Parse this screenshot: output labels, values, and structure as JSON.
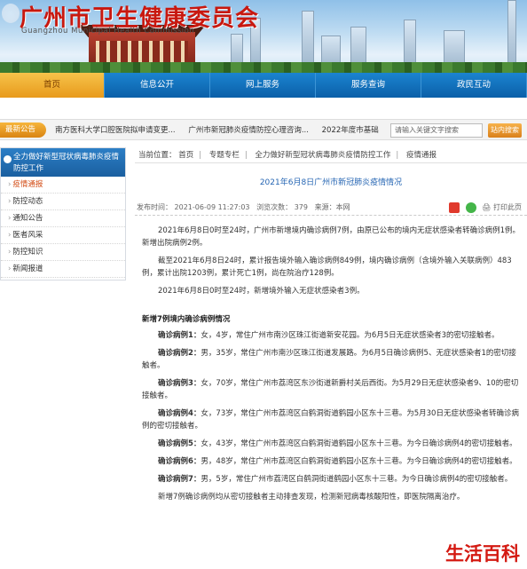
{
  "header": {
    "title": "广州市卫生健康委员会",
    "subtitle": "Guangzhou Municipal Health Commission"
  },
  "nav": {
    "items": [
      "首页",
      "信息公开",
      "网上服务",
      "服务查询",
      "政民互动"
    ]
  },
  "announce": {
    "tag": "最新公告",
    "items": [
      "南方医科大学口腔医院拟申请变更...",
      "广州市新冠肺炎疫情防控心理咨询...",
      "2022年度市基础"
    ],
    "search_placeholder": "请输入关键文字搜索",
    "search_button": "站内搜索"
  },
  "sidebar": {
    "heading": "全力做好新型冠状病毒肺炎疫情防控工作",
    "items": [
      "疫情通报",
      "防控动态",
      "通知公告",
      "医者风采",
      "防控知识",
      "新闻报道"
    ]
  },
  "breadcrumb": {
    "label": "当前位置：",
    "items": [
      "首页",
      "专题专栏",
      "全力做好新型冠状病毒肺炎疫情防控工作",
      "疫情通报"
    ]
  },
  "article": {
    "title": "2021年6月8日广州市新冠肺炎疫情情况",
    "publish_time": "发布时间：  2021-06-09  11:27:03",
    "views": "浏览次数：  379",
    "source": "来源：本网",
    "print": "打印此页",
    "paragraphs": [
      "2021年6月8日0时至24时，广州市新增境内确诊病例7例，由原已公布的境内无症状感染者转确诊病例1例。新增出院病例2例。",
      "截至2021年6月8日24时，累计报告境外输入确诊病例849例，境内确诊病例（含境外输入关联病例）483例，累计出院1203例，累计死亡1例，尚在院治疗128例。",
      "2021年6月8日0时至24时，新增境外输入无症状感染者3例。"
    ],
    "section_heading": "新增7例境内确诊病例情况",
    "cases": [
      {
        "label": "确诊病例1：",
        "text": "女，4岁，常住广州市南沙区珠江街道新安花园。为6月5日无症状感染者3的密切接触者。"
      },
      {
        "label": "确诊病例2：",
        "text": "男，35岁，常住广州市南沙区珠江街道发展路。为6月5日确诊病例5、无症状感染者1的密切接触者。"
      },
      {
        "label": "确诊病例3：",
        "text": "女，70岁，常住广州市荔湾区东沙街道新爵村关后西街。为5月29日无症状感染者9、10的密切接触者。"
      },
      {
        "label": "确诊病例4：",
        "text": "女，73岁，常住广州市荔湾区白鹤洞街道鹤园小区东十三巷。为5月30日无症状感染者转确诊病例的密切接触者。"
      },
      {
        "label": "确诊病例5：",
        "text": "女，43岁，常住广州市荔湾区白鹤洞街道鹤园小区东十三巷。为今日确诊病例4的密切接触者。"
      },
      {
        "label": "确诊病例6：",
        "text": "男，48岁，常住广州市荔湾区白鹤洞街道鹤园小区东十三巷。为今日确诊病例4的密切接触者。"
      },
      {
        "label": "确诊病例7：",
        "text": "男，5岁，常住广州市荔湾区白鹤洞街道鹤园小区东十三巷。为今日确诊病例4的密切接触者。"
      }
    ],
    "closing": "新增7例确诊病例均从密切接触者主动排查发现，检测新冠病毒核酸阳性，即医院隔离治疗。"
  },
  "watermark": "生活百科"
}
